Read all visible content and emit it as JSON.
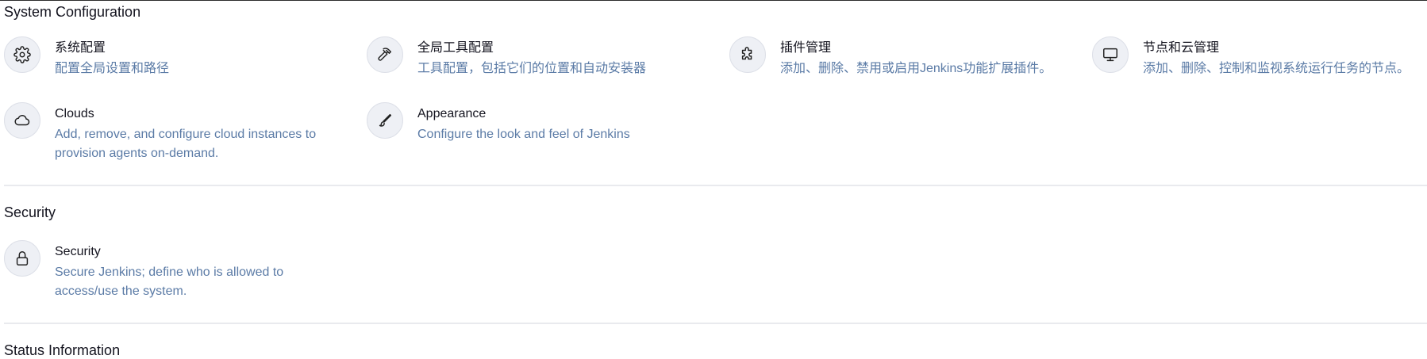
{
  "sections": {
    "system_configuration": {
      "title": "System Configuration",
      "tiles": [
        {
          "title": "系统配置",
          "description": "配置全局设置和路径",
          "icon": "gear-icon"
        },
        {
          "title": "全局工具配置",
          "description": "工具配置，包括它们的位置和自动安装器",
          "icon": "hammer-icon"
        },
        {
          "title": "插件管理",
          "description": "添加、删除、禁用或启用Jenkins功能扩展插件。",
          "icon": "puzzle-icon"
        },
        {
          "title": "节点和云管理",
          "description": "添加、删除、控制和监视系统运行任务的节点。",
          "icon": "monitor-icon"
        },
        {
          "title": "Clouds",
          "description": "Add, remove, and configure cloud instances to provision agents on-demand.",
          "icon": "cloud-icon"
        },
        {
          "title": "Appearance",
          "description": "Configure the look and feel of Jenkins",
          "icon": "brush-icon"
        }
      ]
    },
    "security": {
      "title": "Security",
      "tiles": [
        {
          "title": "Security",
          "description": "Secure Jenkins; define who is allowed to access/use the system.",
          "icon": "lock-icon"
        }
      ]
    },
    "status_information": {
      "title": "Status Information"
    }
  },
  "colors": {
    "icon_background": "#eef0f5",
    "description_text": "#5b7ba6",
    "divider": "#e9eaee"
  }
}
